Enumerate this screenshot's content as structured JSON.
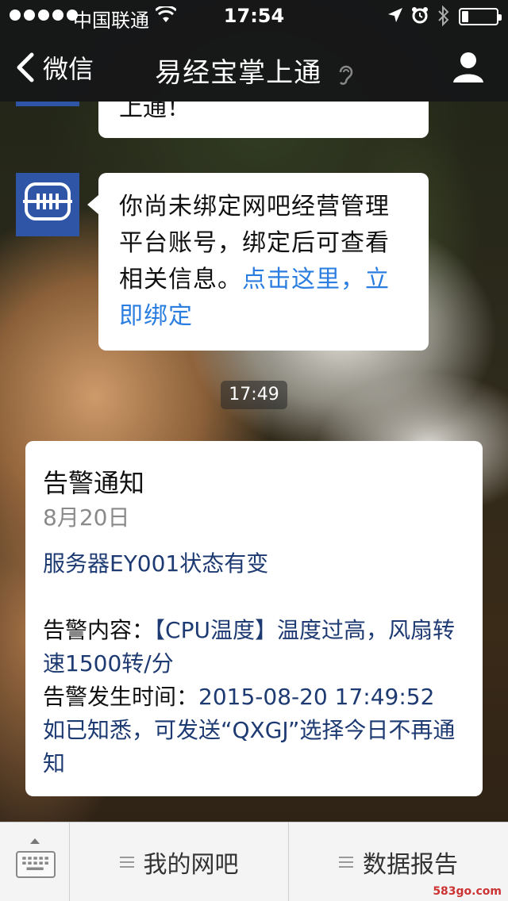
{
  "status_bar": {
    "carrier": "中国联通",
    "time": "17:54",
    "battery_level": 0.18
  },
  "nav": {
    "back_label": "微信",
    "title": "易经宝掌上通"
  },
  "chat": {
    "partial_message": "上通！",
    "message": {
      "text": "你尚未绑定网吧经营管理平台账号，绑定后可查看相关信息。",
      "link_text": "点击这里，立即绑定"
    },
    "timestamp": "17:49",
    "card": {
      "title": "告警通知",
      "date": "8月20日",
      "headline": "服务器EY001状态有变",
      "content_label": "告警内容：",
      "content_value": "【CPU温度】温度过高，风扇转速1500转/分",
      "time_label": "告警发生时间：",
      "time_value": "2015-08-20 17:49:52",
      "footer": "如已知悉，可发送“QXGJ”选择今日不再通知"
    }
  },
  "bottom_menu": {
    "items": [
      "我的网吧",
      "数据报告"
    ]
  },
  "watermark": "583go.com",
  "colors": {
    "link": "#2b7ee0",
    "card_value": "#1e3a72",
    "avatar": "#2f56a6"
  }
}
